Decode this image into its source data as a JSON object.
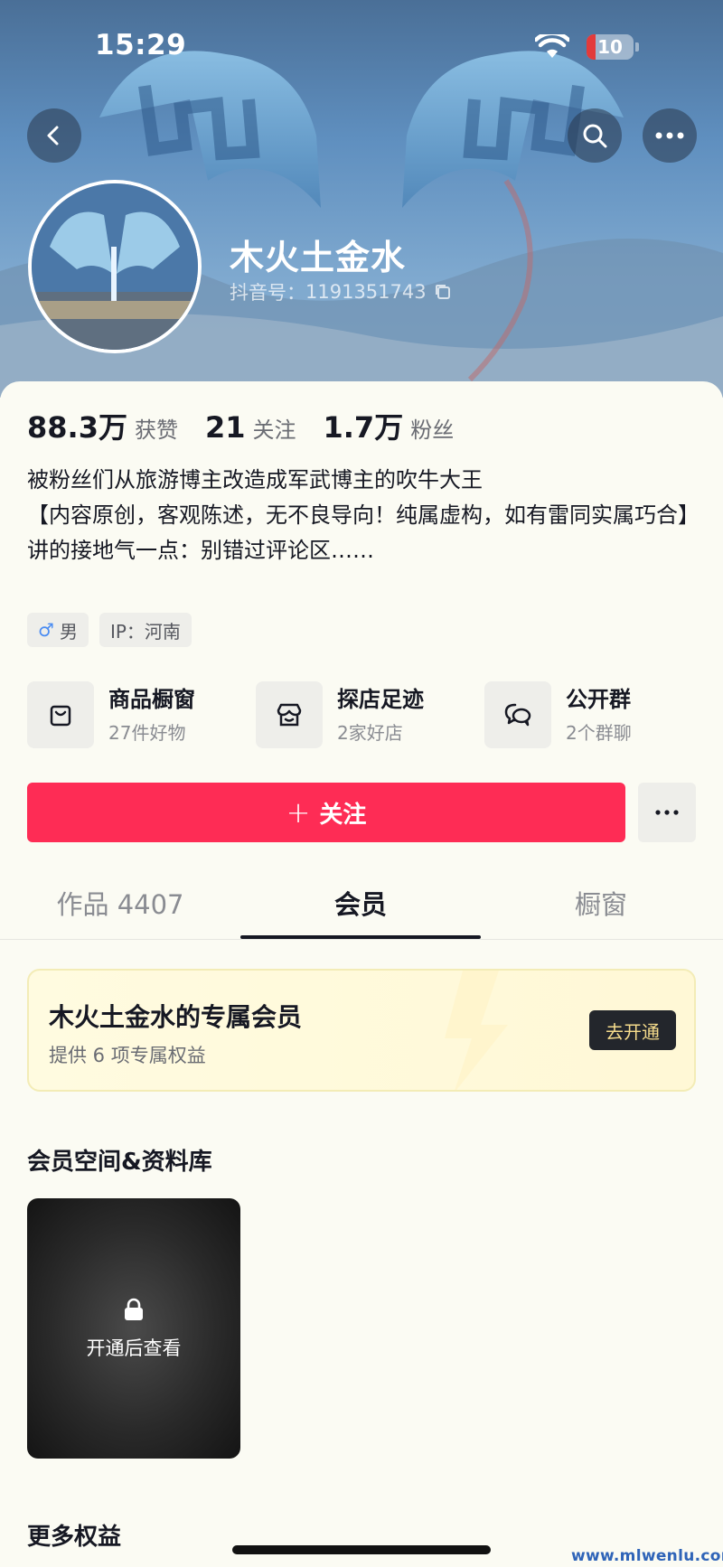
{
  "status_bar": {
    "time": "15:29",
    "battery": "10"
  },
  "profile": {
    "nickname": "木火土金水",
    "douyin_id_label": "抖音号：",
    "douyin_id": "1191351743"
  },
  "stats": [
    {
      "value": "88.3万",
      "label": "获赞"
    },
    {
      "value": "21",
      "label": "关注"
    },
    {
      "value": "1.7万",
      "label": "粉丝"
    }
  ],
  "bio": [
    "被粉丝们从旅游博主改造成军武博主的吹牛大王",
    "【内容原创，客观陈述，无不良导向！纯属虚构，如有雷同实属巧合】",
    "讲的接地气一点：别错过评论区……"
  ],
  "tags": {
    "gender": "男",
    "gender_symbol": "♂",
    "ip": "IP：河南"
  },
  "shortcuts": [
    {
      "title": "商品橱窗",
      "subtitle": "27件好物",
      "icon": "shopping-bag-icon"
    },
    {
      "title": "探店足迹",
      "subtitle": "2家好店",
      "icon": "store-icon"
    },
    {
      "title": "公开群",
      "subtitle": "2个群聊",
      "icon": "chat-bubbles-icon"
    }
  ],
  "follow_button": {
    "plus": "+",
    "label": "关注"
  },
  "tabs": [
    {
      "label": "作品 4407",
      "active": false
    },
    {
      "label": "会员",
      "active": true
    },
    {
      "label": "橱窗",
      "active": false
    }
  ],
  "membership": {
    "title": "木火土金水的专属会员",
    "subtitle": "提供 6 项专属权益",
    "button": "去开通"
  },
  "library": {
    "title": "会员空间&资料库",
    "locked_text": "开通后查看"
  },
  "more_benefits": "更多权益",
  "watermark": "www.mlwenlu.com",
  "colors": {
    "accent": "#fe2c55",
    "member_bg": "#fffbe0",
    "member_button": "#23262c"
  }
}
